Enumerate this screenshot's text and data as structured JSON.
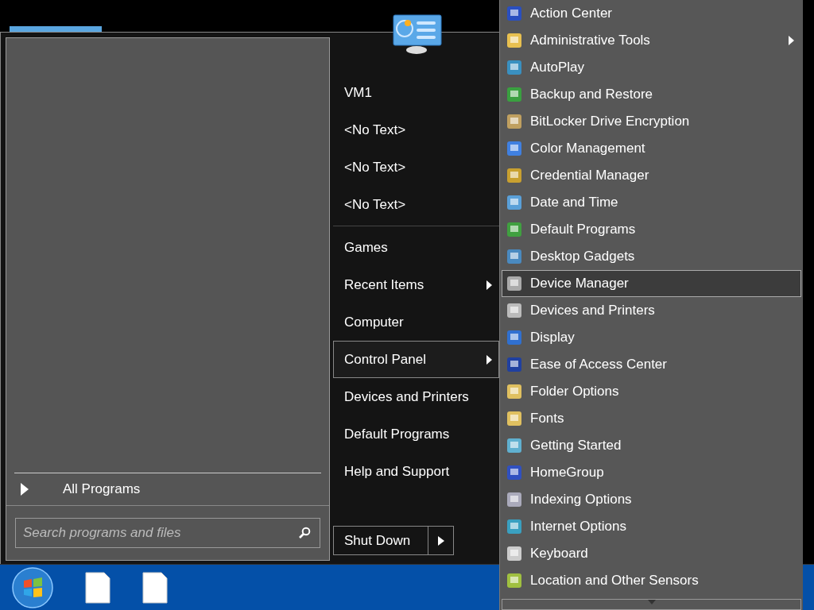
{
  "start_menu": {
    "all_programs": "All Programs",
    "search": {
      "placeholder": "Search programs and files"
    },
    "user_items": [
      {
        "label": "VM1",
        "has_submenu": false,
        "selected": false
      },
      {
        "label": "<No Text>",
        "has_submenu": false,
        "selected": false
      },
      {
        "label": "<No Text>",
        "has_submenu": false,
        "selected": false
      },
      {
        "label": "<No Text>",
        "has_submenu": false,
        "selected": false
      }
    ],
    "system_items": [
      {
        "label": "Games",
        "has_submenu": false,
        "selected": false
      },
      {
        "label": "Recent Items",
        "has_submenu": true,
        "selected": false
      },
      {
        "label": "Computer",
        "has_submenu": false,
        "selected": false
      },
      {
        "label": "Control Panel",
        "has_submenu": true,
        "selected": true
      },
      {
        "label": "Devices and Printers",
        "has_submenu": false,
        "selected": false
      },
      {
        "label": "Default Programs",
        "has_submenu": false,
        "selected": false
      },
      {
        "label": "Help and Support",
        "has_submenu": false,
        "selected": false
      }
    ],
    "shut_down": "Shut Down"
  },
  "control_panel_menu": [
    {
      "label": "Action Center",
      "has_submenu": false,
      "selected": false
    },
    {
      "label": "Administrative Tools",
      "has_submenu": true,
      "selected": false
    },
    {
      "label": "AutoPlay",
      "has_submenu": false,
      "selected": false
    },
    {
      "label": "Backup and Restore",
      "has_submenu": false,
      "selected": false
    },
    {
      "label": "BitLocker Drive Encryption",
      "has_submenu": false,
      "selected": false
    },
    {
      "label": "Color Management",
      "has_submenu": false,
      "selected": false
    },
    {
      "label": "Credential Manager",
      "has_submenu": false,
      "selected": false
    },
    {
      "label": "Date and Time",
      "has_submenu": false,
      "selected": false
    },
    {
      "label": "Default Programs",
      "has_submenu": false,
      "selected": false
    },
    {
      "label": "Desktop Gadgets",
      "has_submenu": false,
      "selected": false
    },
    {
      "label": "Device Manager",
      "has_submenu": false,
      "selected": true
    },
    {
      "label": "Devices and Printers",
      "has_submenu": false,
      "selected": false
    },
    {
      "label": "Display",
      "has_submenu": false,
      "selected": false
    },
    {
      "label": "Ease of Access Center",
      "has_submenu": false,
      "selected": false
    },
    {
      "label": "Folder Options",
      "has_submenu": false,
      "selected": false
    },
    {
      "label": "Fonts",
      "has_submenu": false,
      "selected": false
    },
    {
      "label": "Getting Started",
      "has_submenu": false,
      "selected": false
    },
    {
      "label": "HomeGroup",
      "has_submenu": false,
      "selected": false
    },
    {
      "label": "Indexing Options",
      "has_submenu": false,
      "selected": false
    },
    {
      "label": "Internet Options",
      "has_submenu": false,
      "selected": false
    },
    {
      "label": "Keyboard",
      "has_submenu": false,
      "selected": false
    },
    {
      "label": "Location and Other Sensors",
      "has_submenu": false,
      "selected": false
    }
  ]
}
